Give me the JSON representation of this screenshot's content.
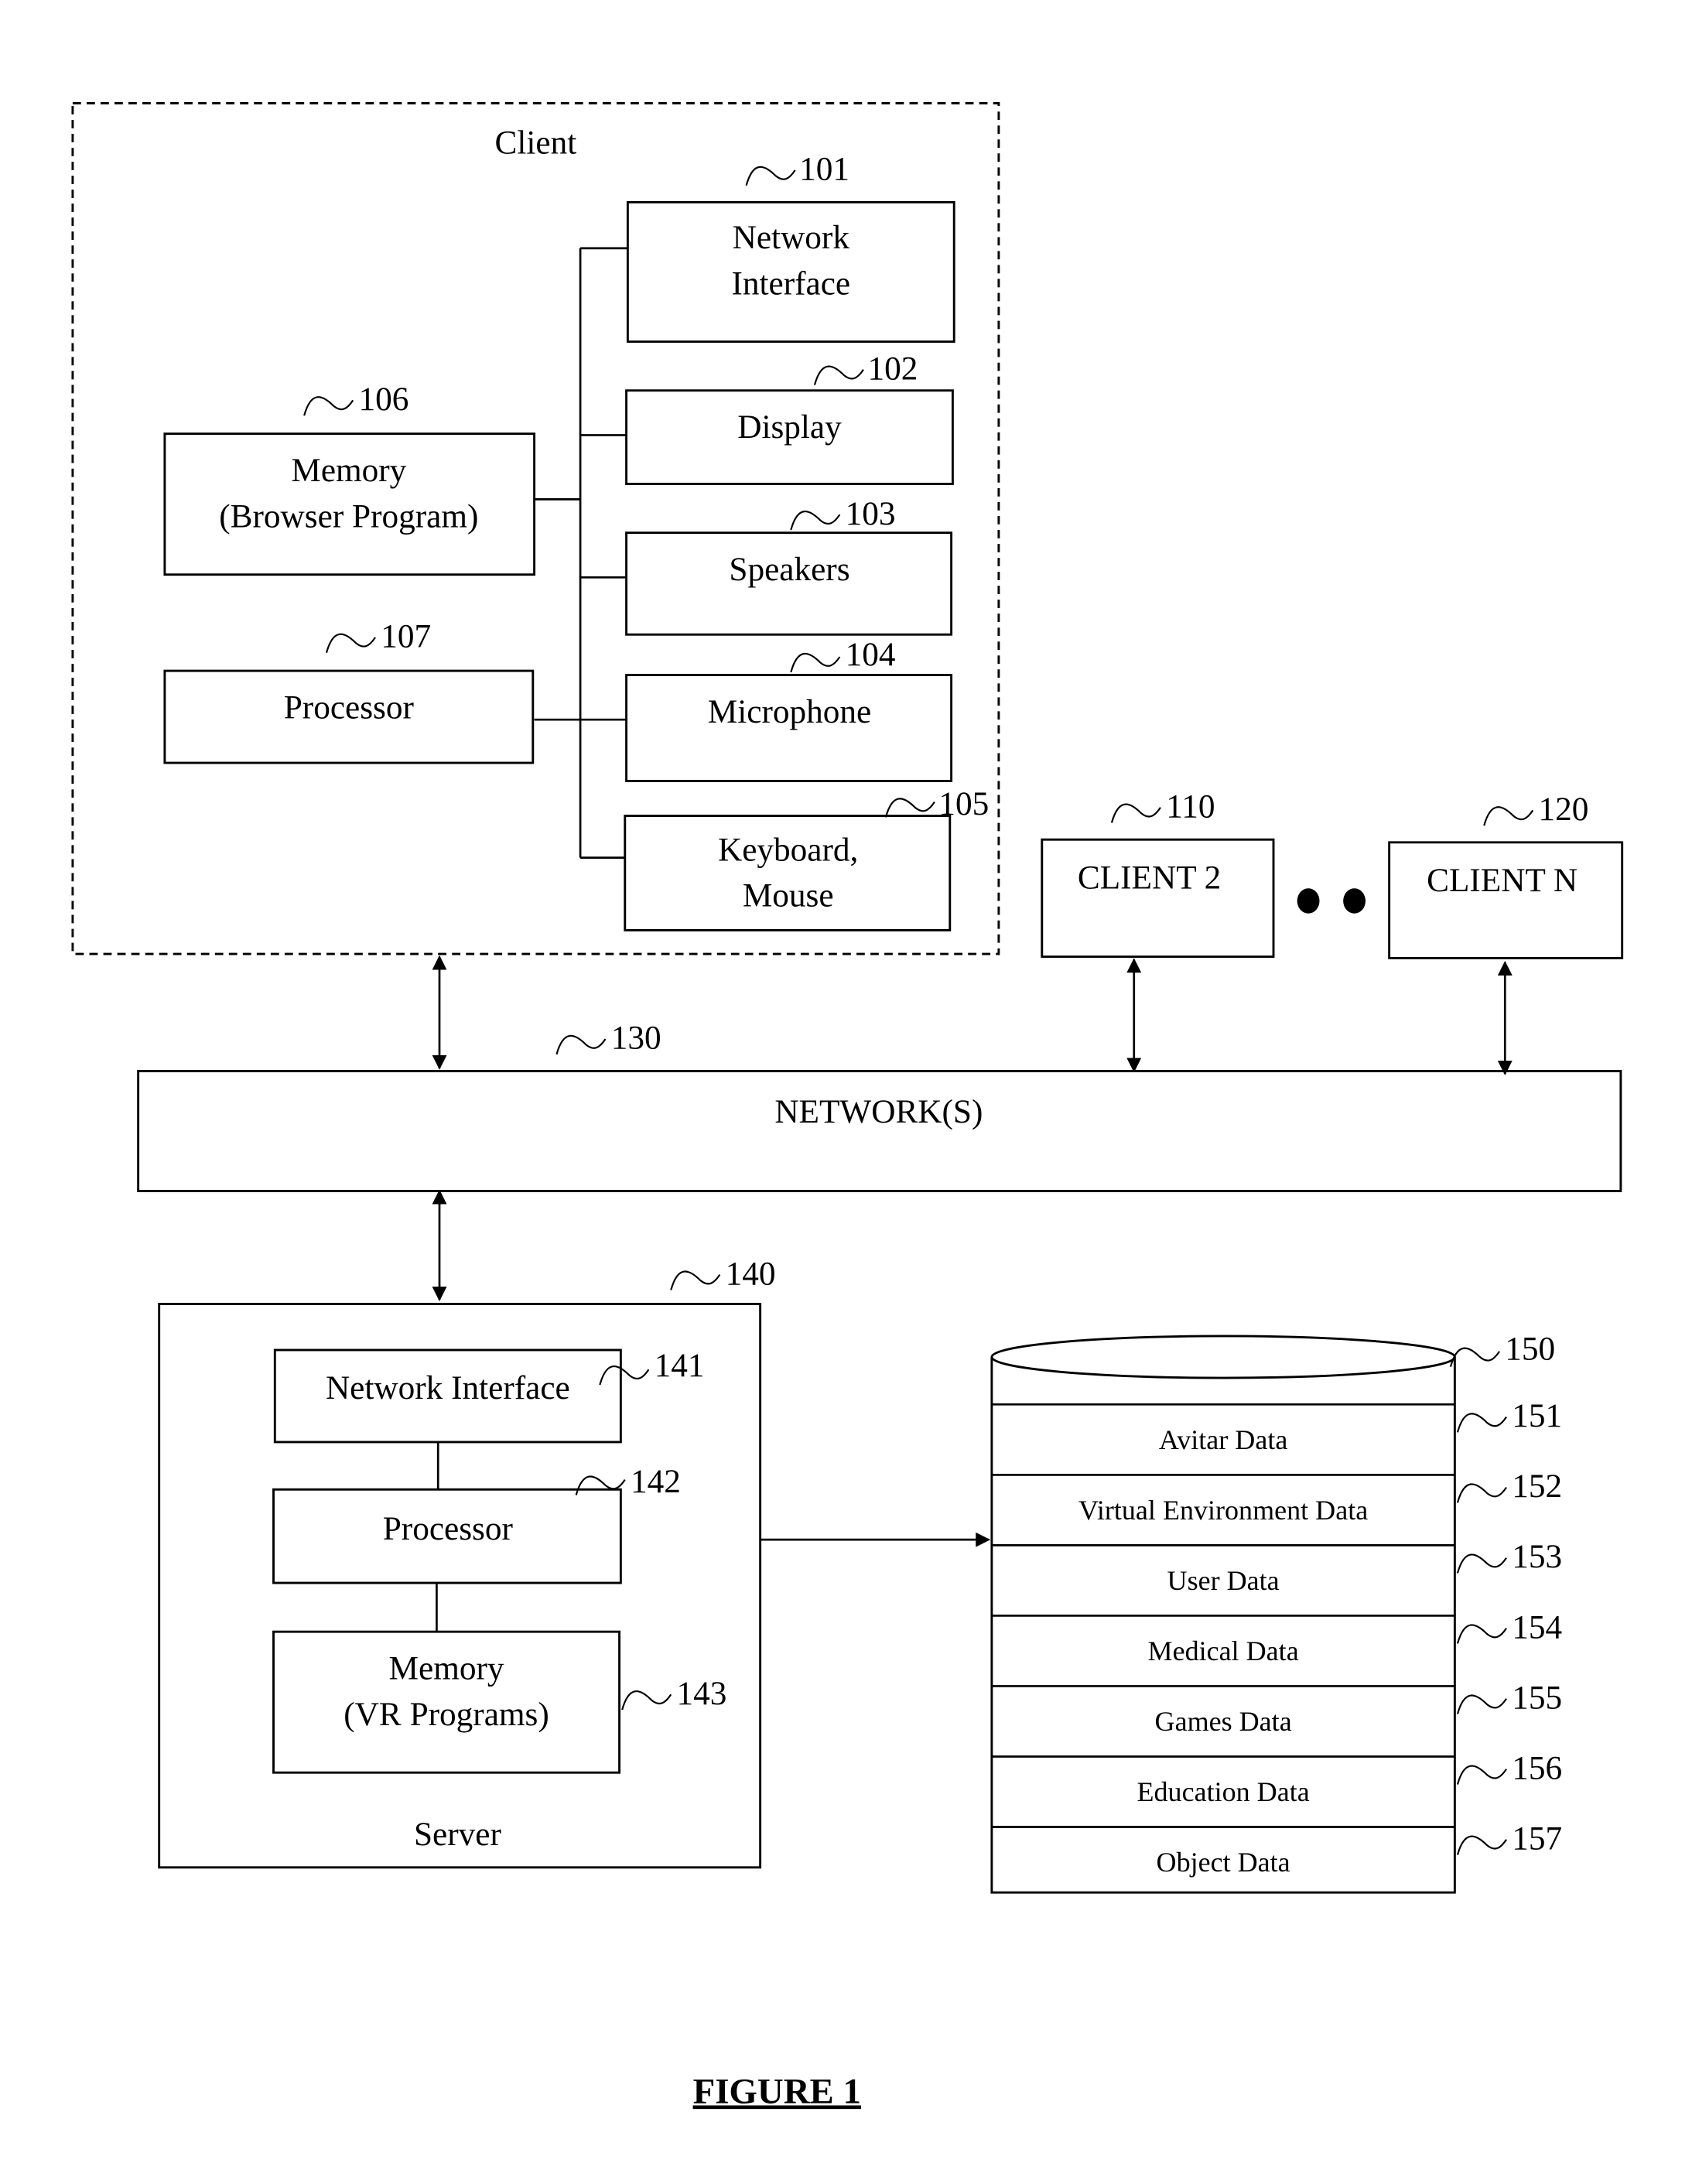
{
  "figure": {
    "caption": "FIGURE 1",
    "client": {
      "title": "Client",
      "components": [
        {
          "ref": "101",
          "label_lines": [
            "Network",
            "Interface"
          ]
        },
        {
          "ref": "102",
          "label_lines": [
            "Display"
          ]
        },
        {
          "ref": "103",
          "label_lines": [
            "Speakers"
          ]
        },
        {
          "ref": "104",
          "label_lines": [
            "Microphone"
          ]
        },
        {
          "ref": "105",
          "label_lines": [
            "Keyboard,",
            "Mouse"
          ]
        },
        {
          "ref": "106",
          "label_lines": [
            "Memory",
            "(Browser Program)"
          ]
        },
        {
          "ref": "107",
          "label_lines": [
            "Processor"
          ]
        }
      ]
    },
    "other_clients": [
      {
        "ref": "110",
        "label": "CLIENT 2"
      },
      {
        "ref": "120",
        "label": "CLIENT N"
      }
    ],
    "network": {
      "ref": "130",
      "label": "NETWORK(S)"
    },
    "server": {
      "ref": "140",
      "title": "Server",
      "components": [
        {
          "ref": "141",
          "label_lines": [
            "Network Interface"
          ]
        },
        {
          "ref": "142",
          "label_lines": [
            "Processor"
          ]
        },
        {
          "ref": "143",
          "label_lines": [
            "Memory",
            "(VR Programs)"
          ]
        }
      ]
    },
    "database": {
      "ref": "150",
      "rows": [
        {
          "ref": "151",
          "label": "Avitar Data"
        },
        {
          "ref": "152",
          "label": "Virtual Environment Data"
        },
        {
          "ref": "153",
          "label": "User Data"
        },
        {
          "ref": "154",
          "label": "Medical Data"
        },
        {
          "ref": "155",
          "label": "Games Data"
        },
        {
          "ref": "156",
          "label": "Education Data"
        },
        {
          "ref": "157",
          "label": "Object Data"
        }
      ]
    }
  }
}
